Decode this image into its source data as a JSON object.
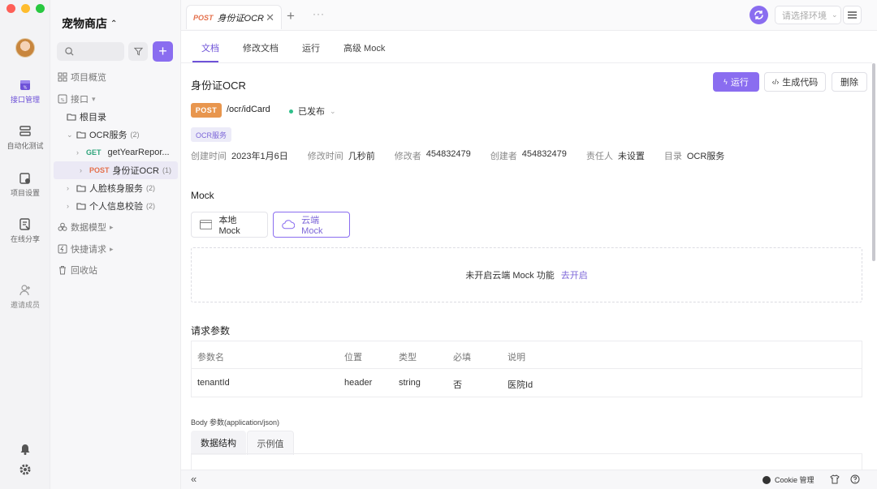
{
  "rail": {
    "items": [
      {
        "label": "接口管理"
      },
      {
        "label": "自动化测试"
      },
      {
        "label": "项目设置"
      },
      {
        "label": "在线分享"
      },
      {
        "label": "邀请成员"
      }
    ]
  },
  "tree": {
    "project_title": "宠物商店",
    "project_chevron": "⌃⌄",
    "nodes": [
      {
        "label": "项目概览"
      },
      {
        "label": "接口"
      },
      {
        "label": "根目录"
      },
      {
        "label": "OCR服务",
        "count": "(2)"
      },
      {
        "method": "GET",
        "label": "getYearRepor..."
      },
      {
        "method": "POST",
        "label": "身份证OCR",
        "count": "(1)"
      },
      {
        "label": "人脸核身服务",
        "count": "(2)"
      },
      {
        "label": "个人信息校验",
        "count": "(2)"
      },
      {
        "label": "数据模型"
      },
      {
        "label": "快捷请求"
      },
      {
        "label": "回收站"
      }
    ]
  },
  "topbar": {
    "tab_method": "POST",
    "tab_title": "身份证OCR",
    "close": "✕",
    "add": "+",
    "more": "···",
    "env_placeholder": "请选择环境"
  },
  "subtabs": [
    "文档",
    "修改文档",
    "运行",
    "高级 Mock"
  ],
  "api": {
    "title": "身份证OCR",
    "run": "运行",
    "gen_code": "生成代码",
    "delete": "删除",
    "method": "POST",
    "path": "/ocr/idCard",
    "status": "已发布",
    "tag": "OCR服务",
    "meta": [
      {
        "k": "创建时间",
        "v": "2023年1月6日"
      },
      {
        "k": "修改时间",
        "v": "几秒前"
      },
      {
        "k": "修改者",
        "v": "454832479"
      },
      {
        "k": "创建者",
        "v": "454832479"
      },
      {
        "k": "责任人",
        "v": "未设置"
      },
      {
        "k": "目录",
        "v": "OCR服务"
      }
    ]
  },
  "mock": {
    "title": "Mock",
    "local": "本地 Mock",
    "cloud": "云端 Mock",
    "notice": "未开启云端 Mock 功能",
    "enable": "去开启"
  },
  "params": {
    "title": "请求参数",
    "headers": [
      "参数名",
      "位置",
      "类型",
      "必填",
      "说明"
    ],
    "rows": [
      [
        "tenantId",
        "header",
        "string",
        "否",
        "医院Id"
      ]
    ]
  },
  "body": {
    "label": "Body 参数(application/json)",
    "tabs": [
      "数据结构",
      "示例值"
    ]
  },
  "statusbar": {
    "collapse": "«",
    "cookie": "Cookie 管理"
  },
  "colors": {
    "accent": "#8a6df0",
    "post": "#e8964e",
    "get": "#2fa47b",
    "published": "#2fbf8a"
  }
}
